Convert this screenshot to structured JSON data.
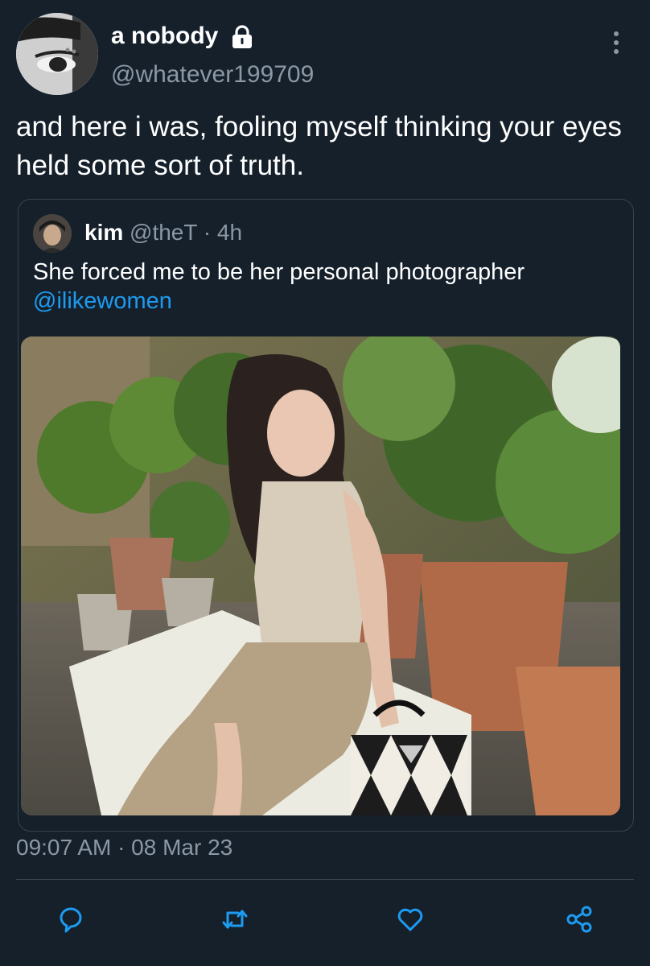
{
  "tweet": {
    "author": {
      "display_name": "a nobody",
      "handle": "@whatever199709",
      "protected_icon": "lock-icon"
    },
    "text": "and here i was, fooling myself thinking your eyes held some sort of truth.",
    "timestamp": "09:07 AM · 08 Mar 23",
    "more_icon": "more-vertical-icon"
  },
  "quoted_tweet": {
    "name": "kim",
    "handle": "@theT",
    "separator": "·",
    "time_ago": "4h",
    "text": "She forced me to be her personal photographer",
    "mention": "@ilikewomen"
  },
  "actions": [
    {
      "name": "reply",
      "icon": "speech-bubble-icon"
    },
    {
      "name": "retweet",
      "icon": "retweet-icon"
    },
    {
      "name": "like",
      "icon": "heart-icon"
    },
    {
      "name": "share",
      "icon": "share-nodes-icon"
    }
  ],
  "colors": {
    "background": "#15202b",
    "text": "#ffffff",
    "secondary": "#8b98a5",
    "border": "#38444d",
    "link": "#1d9bf0"
  }
}
